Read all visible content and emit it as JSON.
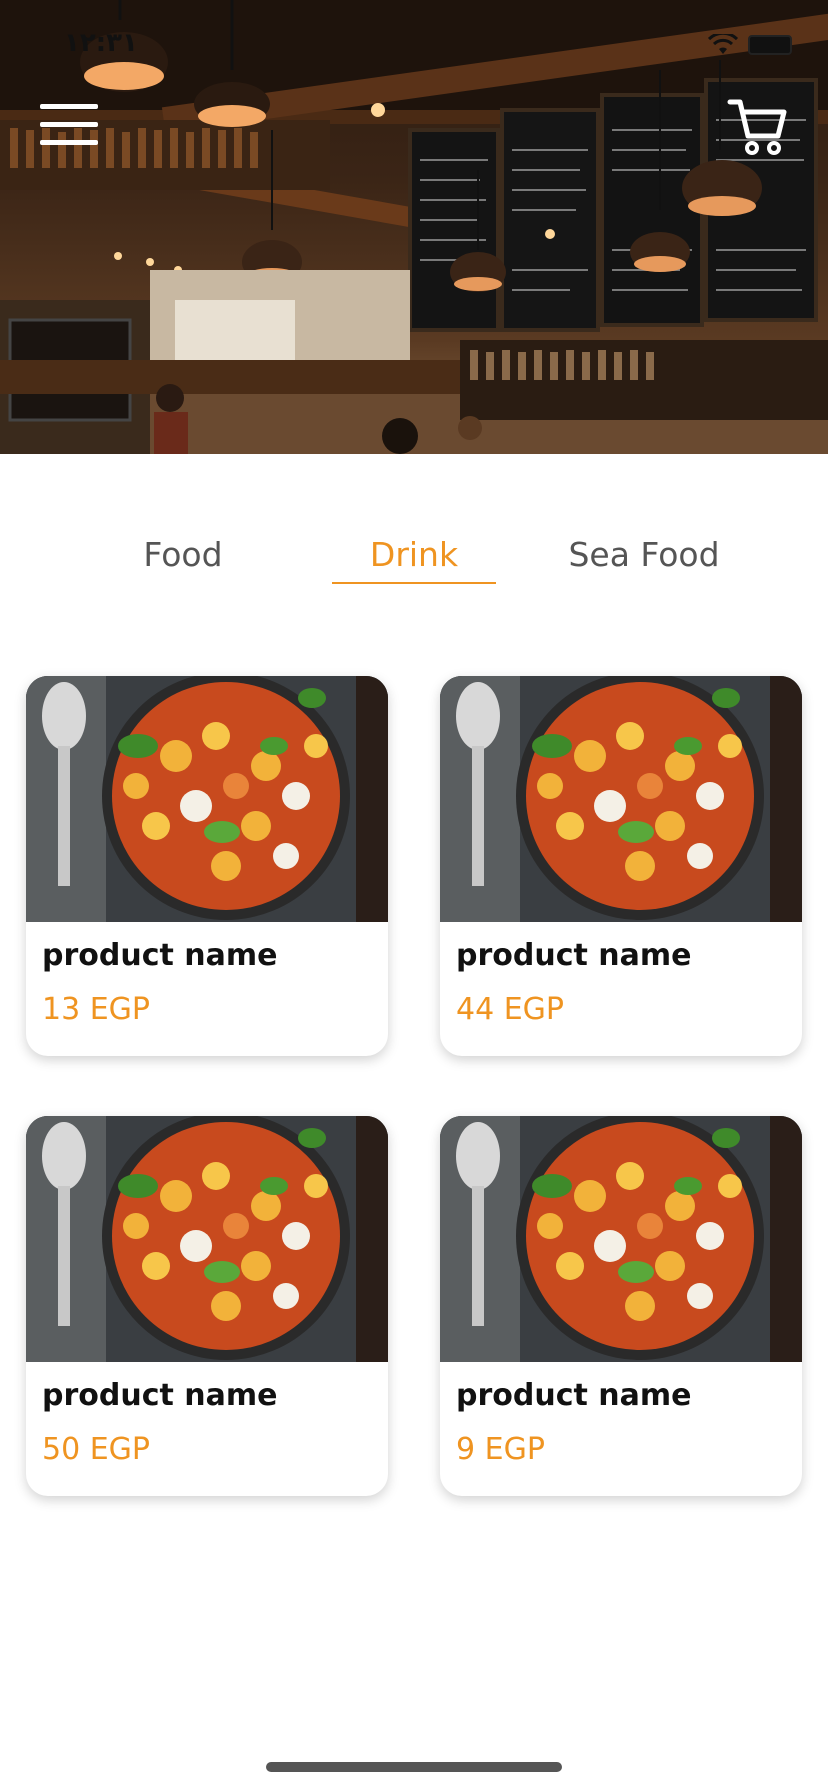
{
  "status_bar": {
    "time": "١٢:٣١"
  },
  "header": {
    "menu_icon": "hamburger-menu-icon",
    "cart_icon": "shopping-cart-icon"
  },
  "tabs": [
    {
      "label": "Food",
      "active": false
    },
    {
      "label": "Drink",
      "active": true
    },
    {
      "label": "Sea Food",
      "active": false
    }
  ],
  "products": [
    {
      "name": "product name",
      "price": "13 EGP"
    },
    {
      "name": "product name",
      "price": "44 EGP"
    },
    {
      "name": "product name",
      "price": "50 EGP"
    },
    {
      "name": "product name",
      "price": "9 EGP"
    }
  ],
  "colors": {
    "accent": "#ef9421",
    "tab_inactive": "#555555",
    "card_title": "#111111"
  }
}
